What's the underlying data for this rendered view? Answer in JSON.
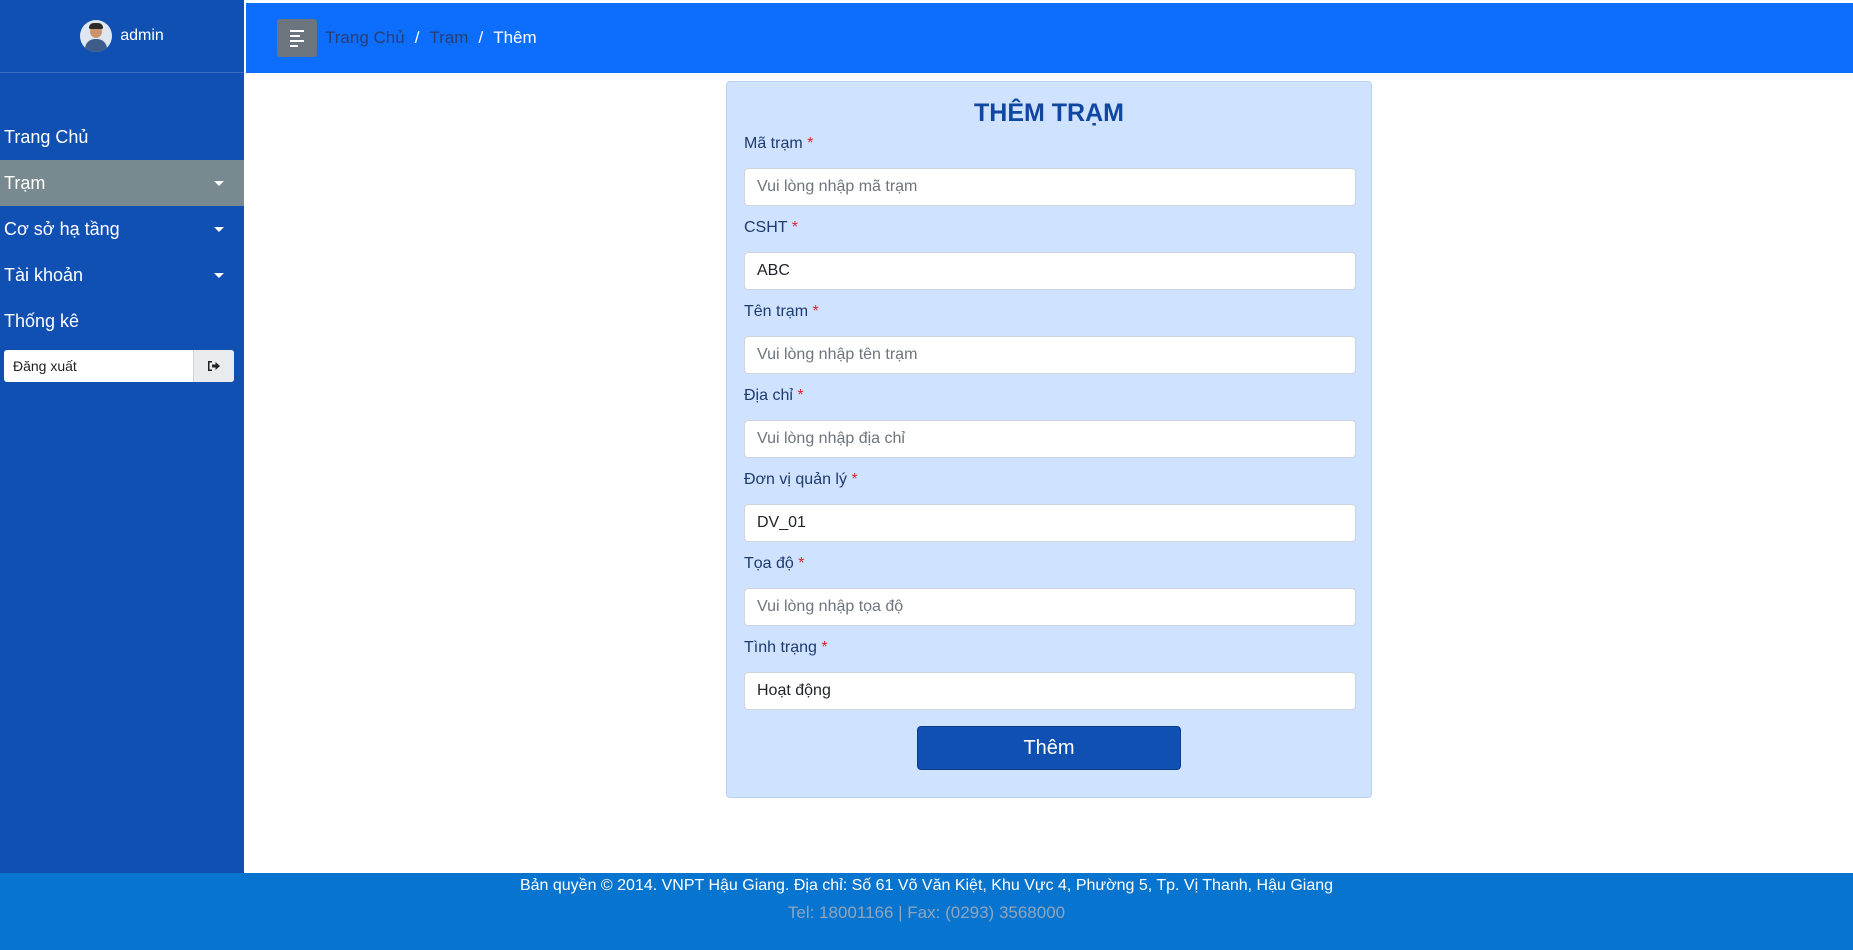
{
  "user": {
    "name": "admin"
  },
  "sidebar": {
    "items": [
      {
        "label": "Trang Chủ",
        "has_caret": false,
        "active": false
      },
      {
        "label": "Trạm",
        "has_caret": true,
        "active": true
      },
      {
        "label": "Cơ sở hạ tầng",
        "has_caret": true,
        "active": false
      },
      {
        "label": "Tài khoản",
        "has_caret": true,
        "active": false
      },
      {
        "label": "Thống kê",
        "has_caret": false,
        "active": false
      }
    ],
    "logout_label": "Đăng xuất",
    "logout_icon": "sign-out-icon"
  },
  "header": {
    "toggle_icon": "menu-toggle-icon",
    "breadcrumb": [
      "Trang Chủ",
      "Trạm",
      "Thêm"
    ]
  },
  "form": {
    "title": "THÊM TRẠM",
    "required_mark": "*",
    "fields": [
      {
        "label": "Mã trạm",
        "value": "",
        "placeholder": "Vui lòng nhập mã trạm"
      },
      {
        "label": "CSHT",
        "value": "ABC",
        "placeholder": ""
      },
      {
        "label": "Tên trạm",
        "value": "",
        "placeholder": "Vui lòng nhập tên trạm"
      },
      {
        "label": "Địa chỉ",
        "value": "",
        "placeholder": "Vui lòng nhập địa chỉ"
      },
      {
        "label": "Đơn vị quản lý",
        "value": "DV_01",
        "placeholder": ""
      },
      {
        "label": "Tọa độ",
        "value": "",
        "placeholder": "Vui lòng nhập tọa độ"
      },
      {
        "label": "Tình trạng",
        "value": "Hoạt động",
        "placeholder": ""
      }
    ],
    "submit_label": "Thêm"
  },
  "footer": {
    "line1": "Bản quyền © 2014. VNPT Hậu Giang. Địa chỉ: Số 61 Võ Văn Kiệt, Khu Vực 4, Phường 5, Tp. Vị Thanh, Hậu Giang",
    "line2": "Tel: 18001166 | Fax: (0293) 3568000"
  },
  "colors": {
    "sidebar_bg": "#1150b3",
    "header_bg": "#0d6efd",
    "active_item_bg": "#78898f",
    "form_bg": "#cfe2ff",
    "title_color": "#0f47a1",
    "button_bg": "#1150b3",
    "footer_bg": "#0775cf",
    "required_color": "#e0242f"
  }
}
